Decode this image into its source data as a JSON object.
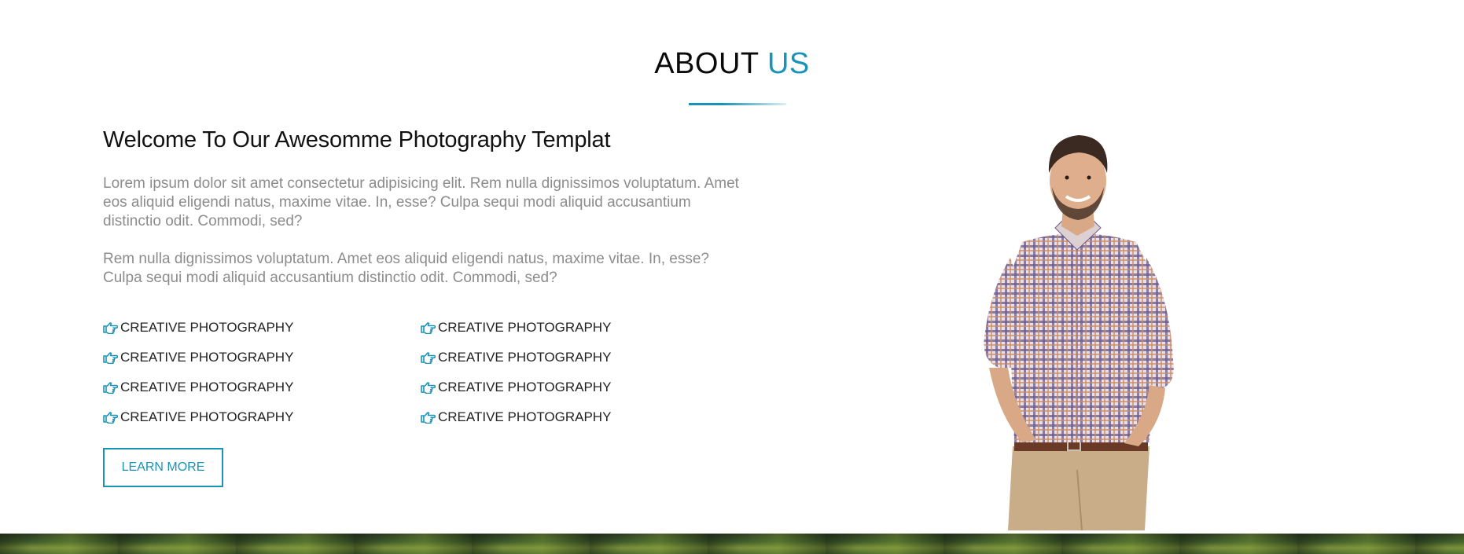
{
  "header": {
    "title_main": "ABOUT",
    "title_accent": "US"
  },
  "about": {
    "heading": "Welcome To Our Awesomme Photography Templat",
    "paragraphs": [
      "Lorem ipsum dolor sit amet consectetur adipisicing elit. Rem nulla dignissimos voluptatum. Amet eos aliquid eligendi natus, maxime vitae. In, esse? Culpa sequi modi aliquid accusantium distinctio odit. Commodi, sed?",
      "Rem nulla dignissimos voluptatum. Amet eos aliquid eligendi natus, maxime vitae. In, esse? Culpa sequi modi aliquid accusantium distinctio odit. Commodi, sed?"
    ],
    "features": [
      "CREATIVE PHOTOGRAPHY",
      "CREATIVE PHOTOGRAPHY",
      "CREATIVE PHOTOGRAPHY",
      "CREATIVE PHOTOGRAPHY",
      "CREATIVE PHOTOGRAPHY",
      "CREATIVE PHOTOGRAPHY",
      "CREATIVE PHOTOGRAPHY",
      "CREATIVE PHOTOGRAPHY"
    ],
    "feature_icon": "hand-pointing-right-icon",
    "button_label": "LEARN MORE"
  },
  "colors": {
    "accent": "#1a93b8",
    "text": "#111111",
    "muted": "#8c8c8c"
  }
}
